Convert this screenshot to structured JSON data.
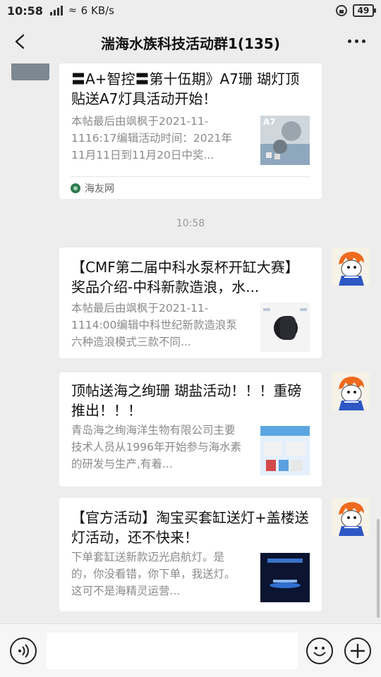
{
  "status_bar": {
    "time": "10:58",
    "network_type": "2G",
    "net_speed": "6 KB/s",
    "battery": "49"
  },
  "header": {
    "title": "湍海水族科技活动群1(135)"
  },
  "messages": [
    {
      "title": "〓A+智控〓第十伍期》A7珊 瑚灯顶贴送A7灯具活动开始！",
      "desc": "本帖最后由飒枫于2021-11-1116:17编辑活动时间：2021年11月11日到11月20日中奖...",
      "thumb_label": "A7",
      "source": "海友网"
    },
    {
      "title": "【CMF第二届中科水泵杯开缸大赛】奖品介绍-中科新款造浪，水...",
      "desc": "本帖最后由飒枫于2021-11-1114:00编辑中科世纪新款造浪泵六种造浪模式三款不同..."
    },
    {
      "title": "顶帖送海之绚珊 瑚盐活动！！！重磅推出！！！",
      "desc": "青岛海之绚海洋生物有限公司主要技术人员从1996年开始参与海水素的研发与生产,有着..."
    },
    {
      "title": "【官方活动】淘宝买套缸送灯+盖楼送灯活动，还不快来！",
      "desc": "下单套缸送新款迈光启航灯。是的，你没看错，你下单，我送灯。这可不是海精灵运营..."
    }
  ],
  "time_separator": "10:58",
  "input_bar": {
    "placeholder": ""
  },
  "colors": {
    "background": "#ededed",
    "card": "#ffffff",
    "title_text": "#111111",
    "desc_text": "#8a8a8a"
  }
}
